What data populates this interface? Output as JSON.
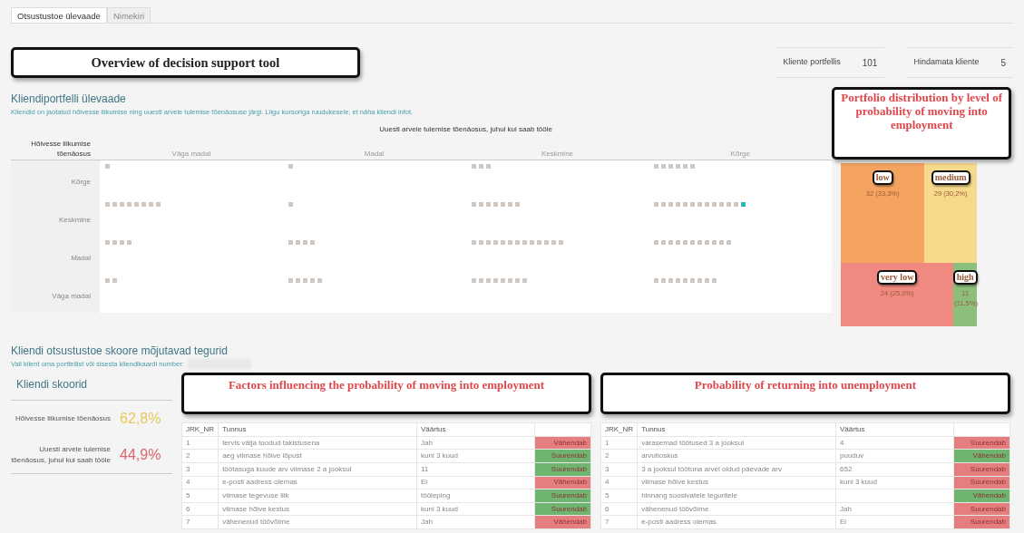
{
  "tabs": [
    {
      "label": "Otsustustoe ülevaade",
      "selected": true
    },
    {
      "label": "Nimekiri",
      "selected": false
    }
  ],
  "overview_callout": "Overview of decision support tool",
  "kpis": [
    {
      "label": "Kliente portfellis",
      "value": "101"
    },
    {
      "label": "Hindamata kliente",
      "value": "5"
    }
  ],
  "portfolio": {
    "title": "Kliendiportfelli ülevaade",
    "subtitle": "Kliendid on jaotatud hõivesse liikumise ning uuesti arvele tulemise tõenäosuse järgi. Liigu kursoriga ruudukesele, et näha kliendi infot.",
    "column_axis_title": "Uuesti arvele tulemise tõenäosus, juhul kui saab tööle",
    "row_axis_title": "Hõivesse liikumise tõenäosus",
    "columns": [
      "Väga madal",
      "Madal",
      "Keskmine",
      "Kõrge"
    ],
    "rows": [
      {
        "label": "Kõrge",
        "cells": [
          [
            {
              "selected": false
            }
          ],
          [
            {
              "selected": false
            }
          ],
          [
            {
              "selected": false
            },
            {
              "selected": false
            },
            {
              "selected": false
            }
          ],
          [
            {
              "selected": false
            },
            {
              "selected": false
            },
            {
              "selected": false
            },
            {
              "selected": false
            },
            {
              "selected": false
            },
            {
              "selected": false
            }
          ]
        ]
      },
      {
        "label": "Keskmine",
        "cells": [
          [
            {
              "selected": false
            },
            {
              "selected": false
            },
            {
              "selected": false
            },
            {
              "selected": false
            },
            {
              "selected": false
            },
            {
              "selected": false
            },
            {
              "selected": false
            },
            {
              "selected": false
            }
          ],
          [
            {
              "selected": false
            }
          ],
          [
            {
              "selected": false
            },
            {
              "selected": false
            },
            {
              "selected": false
            },
            {
              "selected": false
            },
            {
              "selected": false
            },
            {
              "selected": false
            },
            {
              "selected": false
            }
          ],
          [
            {
              "selected": false
            },
            {
              "selected": false
            },
            {
              "selected": false
            },
            {
              "selected": false
            },
            {
              "selected": false
            },
            {
              "selected": false
            },
            {
              "selected": false
            },
            {
              "selected": false
            },
            {
              "selected": false
            },
            {
              "selected": false
            },
            {
              "selected": false
            },
            {
              "selected": false
            },
            {
              "selected": true
            }
          ]
        ]
      },
      {
        "label": "Madal",
        "cells": [
          [
            {
              "selected": false
            },
            {
              "selected": false
            },
            {
              "selected": false
            },
            {
              "selected": false
            }
          ],
          [
            {
              "selected": false
            },
            {
              "selected": false
            },
            {
              "selected": false
            },
            {
              "selected": false
            }
          ],
          [
            {
              "selected": false
            },
            {
              "selected": false
            },
            {
              "selected": false
            },
            {
              "selected": false
            },
            {
              "selected": false
            },
            {
              "selected": false
            },
            {
              "selected": false
            },
            {
              "selected": false
            },
            {
              "selected": false
            },
            {
              "selected": false
            },
            {
              "selected": false
            },
            {
              "selected": false
            },
            {
              "selected": false
            }
          ],
          [
            {
              "selected": false
            },
            {
              "selected": false
            },
            {
              "selected": false
            },
            {
              "selected": false
            },
            {
              "selected": false
            },
            {
              "selected": false
            },
            {
              "selected": false
            },
            {
              "selected": false
            },
            {
              "selected": false
            },
            {
              "selected": false
            },
            {
              "selected": false
            }
          ]
        ]
      },
      {
        "label": "Väga madal",
        "cells": [
          [
            {
              "selected": false
            },
            {
              "selected": false
            }
          ],
          [
            {
              "selected": false
            },
            {
              "selected": false
            },
            {
              "selected": false
            },
            {
              "selected": false
            },
            {
              "selected": false
            }
          ],
          [
            {
              "selected": false
            },
            {
              "selected": false
            },
            {
              "selected": false
            },
            {
              "selected": false
            },
            {
              "selected": false
            },
            {
              "selected": false
            },
            {
              "selected": false
            },
            {
              "selected": false
            }
          ],
          [
            {
              "selected": false
            },
            {
              "selected": false
            },
            {
              "selected": false
            },
            {
              "selected": false
            },
            {
              "selected": false
            },
            {
              "selected": false
            },
            {
              "selected": false
            },
            {
              "selected": false
            },
            {
              "selected": false
            }
          ]
        ]
      }
    ]
  },
  "distribution": {
    "callout": "Portfolio distribution by level of probability of moving into employment",
    "tiles": [
      {
        "callout": "low",
        "value": "32 (33,3%)",
        "color": "#f4a460"
      },
      {
        "callout": "medium",
        "value": "29 (30,2%)",
        "color": "#f6d98a"
      },
      {
        "callout": "very low",
        "value": "24 (25,0%)",
        "color": "#f08a80"
      },
      {
        "callout": "high",
        "value": "11 (11,5%)",
        "color": "#8cc07a"
      }
    ]
  },
  "factors": {
    "title": "Kliendi otsustustoe skoore mõjutavad tegurid",
    "subtitle": "Vali klient oma portfellist või sisesta kliendikaardi number:",
    "scores": {
      "title": "Kliendi skoorid",
      "items": [
        {
          "label": "Hõivesse liikumise tõenäosus",
          "value": "62,8%",
          "color": "#e8c85a"
        },
        {
          "label": "Uuesti arvele tulemise tõenäosus, juhul kui saab tööle",
          "value": "44,9%",
          "color": "#d9646a"
        }
      ]
    },
    "tables": [
      {
        "callout": "Factors influencing the probability of moving into employment",
        "columns": [
          "JRK_NR",
          "Tunnus",
          "Väärtus"
        ],
        "rows": [
          {
            "nr": "1",
            "feature": "tervis välja toodud takistusena",
            "value": "Jah",
            "effect": "Vähendab",
            "color": "#e57f7f"
          },
          {
            "nr": "2",
            "feature": "aeg viimase hõive lõpust",
            "value": "kuni 3 kuud",
            "effect": "Suurendab",
            "color": "#6fb56f"
          },
          {
            "nr": "3",
            "feature": "töötasuga kuude arv viimase 2 a jooksul",
            "value": "11",
            "effect": "Suurendab",
            "color": "#6fb56f"
          },
          {
            "nr": "4",
            "feature": "e-posti aadress olemas",
            "value": "Ei",
            "effect": "Vähendab",
            "color": "#e57f7f"
          },
          {
            "nr": "5",
            "feature": "viimase tegevuse liik",
            "value": "tööleping",
            "effect": "Suurendab",
            "color": "#6fb56f"
          },
          {
            "nr": "6",
            "feature": "viimase hõive kestus",
            "value": "kuni 3 kuud",
            "effect": "Suurendab",
            "color": "#6fb56f"
          },
          {
            "nr": "7",
            "feature": "vähenenud töövõime",
            "value": "Jah",
            "effect": "Vähendab",
            "color": "#e57f7f"
          }
        ]
      },
      {
        "callout": "Probability of returning into unemployment",
        "columns": [
          "JRK_NR",
          "Tunnus",
          "Väärtus"
        ],
        "rows": [
          {
            "nr": "1",
            "feature": "varasemad töötused 3 a jooksul",
            "value": "4",
            "effect": "Suurendab",
            "color": "#e57f7f"
          },
          {
            "nr": "2",
            "feature": "arvutioskus",
            "value": "puuduv",
            "effect": "Vähendab",
            "color": "#6fb56f"
          },
          {
            "nr": "3",
            "feature": "3 a jooksul töötuna arvel oldud päevade arv",
            "value": "652",
            "effect": "Suurendab",
            "color": "#e57f7f"
          },
          {
            "nr": "4",
            "feature": "viimase hõive kestus",
            "value": "kuni 3 kuud",
            "effect": "Suurendab",
            "color": "#e57f7f"
          },
          {
            "nr": "5",
            "feature": "hinnang soosivatele teguritele",
            "effect": "Vähendab",
            "color": "#6fb56f"
          },
          {
            "nr": "6",
            "feature": "vähenenud töövõime",
            "value": "Jah",
            "effect": "Suurendab",
            "color": "#e57f7f"
          },
          {
            "nr": "7",
            "feature": "e-posti aadress olemas",
            "value": "Ei",
            "effect": "Suurendab",
            "color": "#e57f7f"
          }
        ]
      }
    ]
  }
}
